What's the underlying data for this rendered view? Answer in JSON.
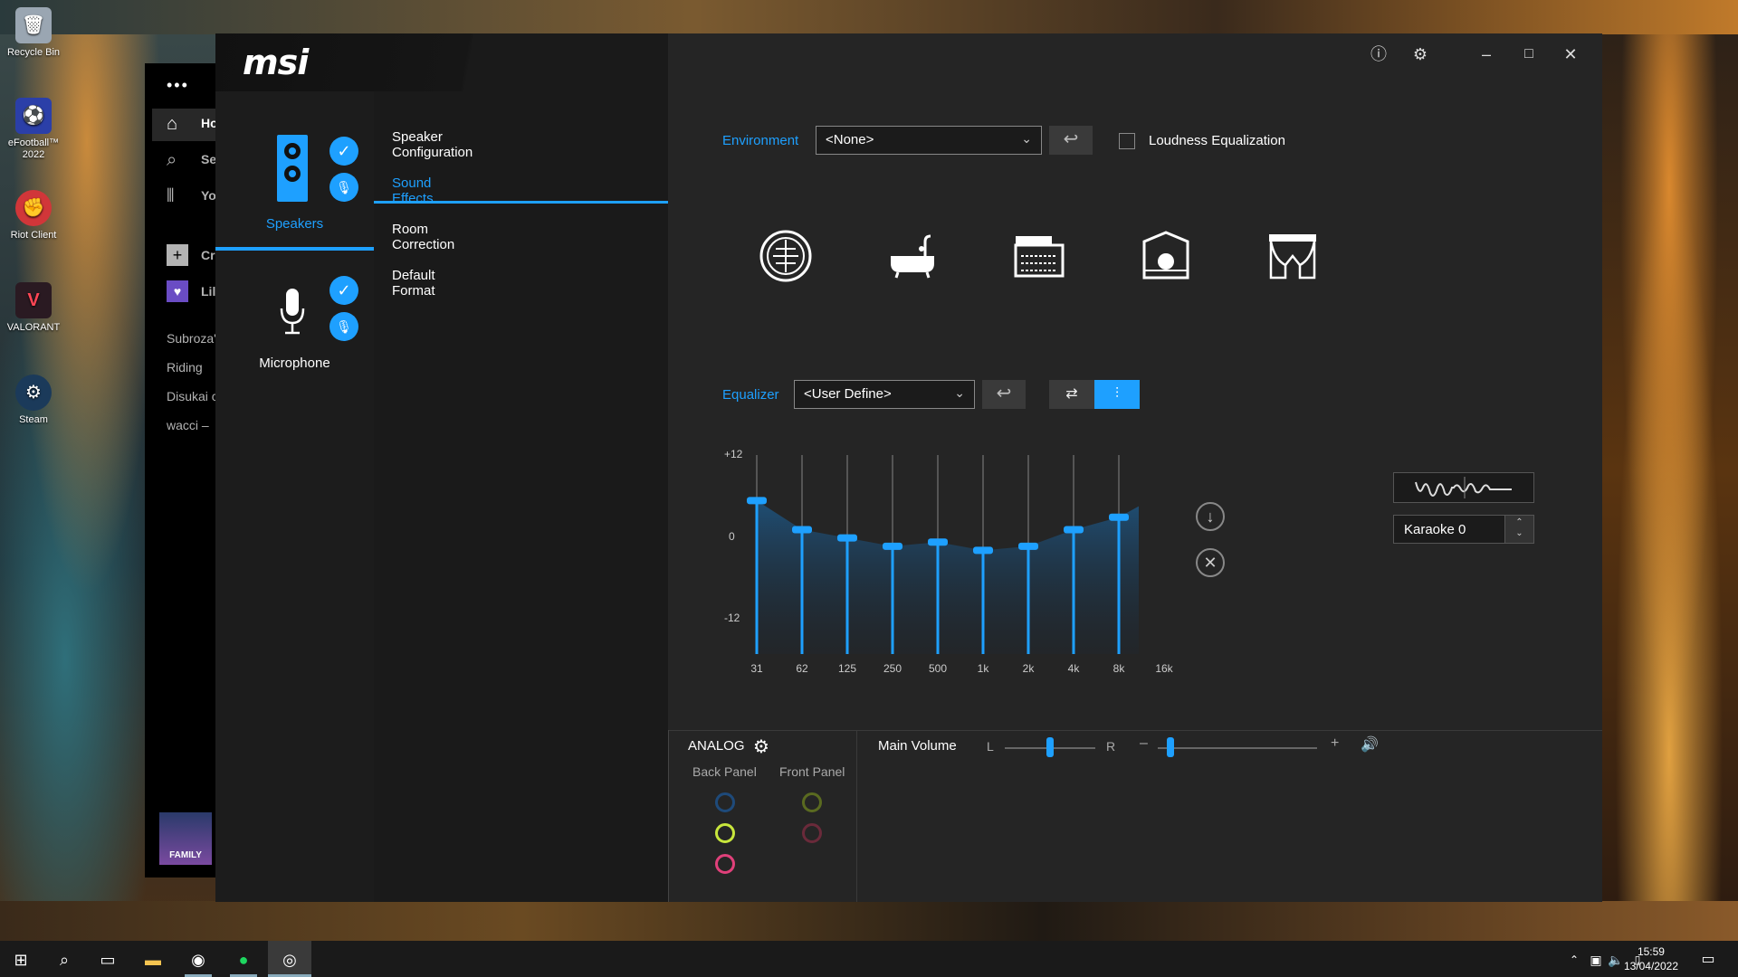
{
  "desktop": {
    "icons": [
      {
        "label": "Recycle Bin",
        "icon": "recycle-bin-icon",
        "color": "#9aa6b2"
      },
      {
        "label": "eFootball™ 2022",
        "icon": "efootball-icon",
        "color": "#2b3fa8"
      },
      {
        "label": "Riot Client",
        "icon": "riot-client-icon",
        "color": "#d13639"
      },
      {
        "label": "VALORANT",
        "icon": "valorant-icon",
        "color": "#2a1a22"
      },
      {
        "label": "Steam",
        "icon": "steam-icon",
        "color": "#1b3a5a"
      }
    ]
  },
  "spotify": {
    "nav": [
      "Ho",
      "Se",
      "Yo"
    ],
    "create": "Cr",
    "liked": "Lil",
    "playlists": [
      "Subroza'",
      "Riding",
      "Disukai c",
      "wacci –"
    ],
    "album_label": "FAMILY"
  },
  "app": {
    "logo": "msi",
    "devices": [
      {
        "label": "Speakers",
        "active": true
      },
      {
        "label": "Microphone",
        "active": false
      }
    ],
    "menu": [
      {
        "label": "Speaker Configuration",
        "active": false
      },
      {
        "label": "Sound Effects",
        "active": true
      },
      {
        "label": "Room Correction",
        "active": false
      },
      {
        "label": "Default Format",
        "active": false
      }
    ],
    "window_controls": {
      "info": "info-icon",
      "settings": "gear-icon",
      "minimize": "–",
      "maximize": "□",
      "close": "✕"
    },
    "environment": {
      "label": "Environment",
      "value": "<None>",
      "loudness_label": "Loudness Equalization",
      "loudness_checked": false,
      "presets": [
        "sphere-icon",
        "bathtub-icon",
        "room-icon",
        "stage-icon",
        "theater-icon"
      ]
    },
    "equalizer": {
      "label": "Equalizer",
      "value": "<User Define>",
      "y_max": "+12",
      "y_mid": "0",
      "y_min": "-12",
      "bands": [
        "31",
        "62",
        "125",
        "250",
        "500",
        "1k",
        "2k",
        "4k",
        "8k",
        "16k"
      ],
      "gains": [
        6.5,
        3.0,
        2.0,
        1.0,
        1.5,
        0.5,
        1.0,
        3.0,
        4.5,
        7.5
      ],
      "karaoke_value": "Karaoke 0"
    },
    "analog": {
      "title": "ANALOG",
      "back_panel": "Back Panel",
      "front_panel": "Front Panel",
      "back_jacks": [
        "#1e4a7a",
        "#c8e63c",
        "#e0407a"
      ],
      "front_jacks": [
        "#5a6a20",
        "#6a2a3a"
      ]
    },
    "volume": {
      "label": "Main Volume",
      "left": "L",
      "right": "R",
      "minus": "–",
      "plus": "+",
      "balance": 0.5,
      "level": 0.08
    }
  },
  "taskbar": {
    "time": "15:59",
    "date": "13/04/2022"
  },
  "colors": {
    "accent": "#1ea0ff"
  }
}
